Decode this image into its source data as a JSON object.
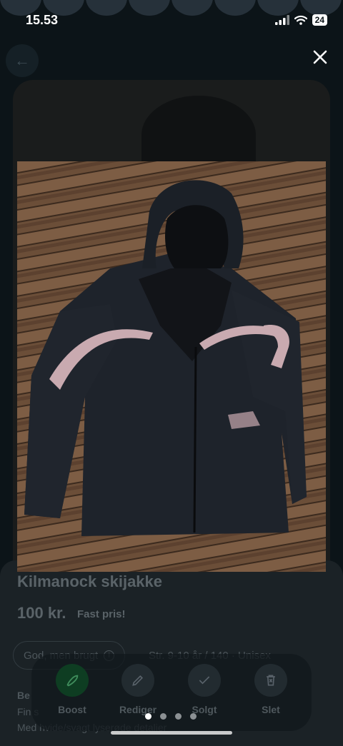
{
  "status_bar": {
    "time": "15.53",
    "battery": "24"
  },
  "listing": {
    "title": "Kilmanock skijakke",
    "price": "100 kr.",
    "price_note": "Fast pris!",
    "condition": "God, men brugt",
    "size": "Str. 9-10 år / 140 · Unisex",
    "description_heading": "Be",
    "description_line1": "Fin s",
    "description_line2": "Med hvide/svagt lyserøde detaljer"
  },
  "actions": [
    {
      "label": "Boost",
      "icon": "rocket-icon"
    },
    {
      "label": "Rediger",
      "icon": "pencil-icon"
    },
    {
      "label": "Solgt",
      "icon": "checkmark-icon"
    },
    {
      "label": "Slet",
      "icon": "trash-icon"
    }
  ],
  "gallery": {
    "total_images": 4,
    "active_index": 0
  },
  "colors": {
    "background": "#0c1418",
    "boost_accent": "#0e3d22",
    "jacket": "#1e232b",
    "stripe": "#c9aab0"
  }
}
